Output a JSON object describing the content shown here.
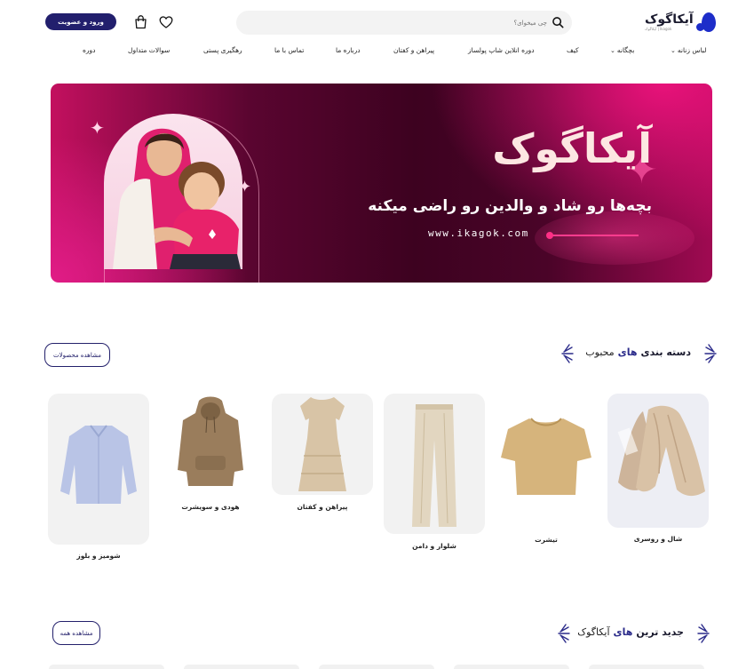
{
  "header": {
    "logo": {
      "name": "آیکاگوک",
      "tagline": "Ikagok | آیکاگوک",
      "icon": "logo-mark-icon"
    },
    "search": {
      "placeholder": "چی میخوای؟",
      "icon": "search-icon"
    },
    "wishlist_icon": "heart-icon",
    "cart_icon": "shopping-bag-icon",
    "login_label": "ورود و عضویت",
    "brand_color": "#221f6d"
  },
  "nav": {
    "items": [
      {
        "label": "لباس زنانه",
        "dropdown": true
      },
      {
        "label": "بچگانه",
        "dropdown": true
      },
      {
        "label": "کیف",
        "dropdown": false
      },
      {
        "label": "دوره انلاین شاپ پولساز",
        "dropdown": false
      },
      {
        "label": "پیراهن و کفتان",
        "dropdown": false
      },
      {
        "label": "درباره ما",
        "dropdown": false
      },
      {
        "label": "تماس با ما",
        "dropdown": false
      },
      {
        "label": "رهگیری پستی",
        "dropdown": false
      },
      {
        "label": "سوالات متداول",
        "dropdown": false
      },
      {
        "label": "دوره",
        "dropdown": false
      }
    ]
  },
  "banner": {
    "title": "آیکاگوک",
    "tagline": "بچه‌ها رو شاد و والدین رو راضی میکنه",
    "url": "www.ikagok.com",
    "colors": {
      "primary": "#c3105f",
      "dark": "#3d0220",
      "accent": "#ff2f86"
    }
  },
  "categories_section": {
    "title_prefix": "دسته بندی",
    "title_highlight": "های",
    "title_suffix": "محبوب",
    "view_button": "مشاهده محصولات",
    "items": [
      {
        "label": "شال و روسری"
      },
      {
        "label": "تیشرت"
      },
      {
        "label": "شلوار و دامن"
      },
      {
        "label": "پیراهن و کفتان"
      },
      {
        "label": "هودی و سویشرت"
      },
      {
        "label": "شومیز و بلوز"
      }
    ]
  },
  "newest_section": {
    "title_prefix": "جدید ترین",
    "title_highlight": "های",
    "title_suffix": "آیکاگوک",
    "view_button": "مشاهده همه"
  }
}
